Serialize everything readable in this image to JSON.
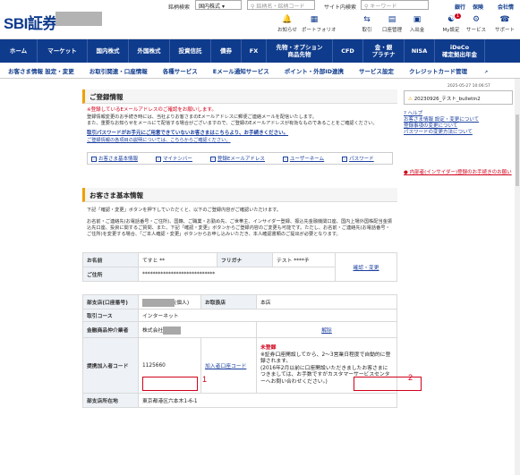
{
  "header": {
    "logo": "SBI証券",
    "stock_search_label": "銘柄検索",
    "stock_search_select": "国内株式",
    "stock_search_placeholder": "銘柄名・銘柄コード",
    "site_search_label": "サイト内検索",
    "site_search_placeholder": "キーワード",
    "links": [
      "銀行",
      "保険",
      "会社情"
    ],
    "icons": [
      {
        "label": "お知らせ",
        "icon": "bell-icon"
      },
      {
        "label": "ポートフォリオ",
        "icon": "portfolio-icon"
      },
      {
        "label": "取引",
        "icon": "trade-icon"
      },
      {
        "label": "口座管理",
        "icon": "account-icon"
      },
      {
        "label": "入出金",
        "icon": "deposit-icon"
      },
      {
        "label": "My設定",
        "icon": "user-icon"
      },
      {
        "label": "サービス",
        "icon": "service-icon"
      },
      {
        "label": "サポート",
        "icon": "support-icon"
      }
    ],
    "badge": "1"
  },
  "nav": [
    "ホーム",
    "マーケット",
    "国内株式",
    "外国株式",
    "投資信託",
    "債券",
    "FX",
    "先物・オプション\n商品先物",
    "CFD",
    "金・銀\nプラチナ",
    "NISA",
    "iDeCo\n確定拠出年金"
  ],
  "subnav": [
    "お客さま情報 設定・変更",
    "お取引関連・口座情報",
    "各種サービス",
    "Eメール通知サービス",
    "ポイント・外部ID連携",
    "サービス設定",
    "クレジットカード管理"
  ],
  "timestamp": "2025-05-27 10:06:57",
  "registration": {
    "title": "ご登録情報",
    "note": "※登録しているEメールアドレスのご確認をお願いします。",
    "para1": "登録情報変更のお手続き時には、当社よりお客さまのEメールアドレスに郵便ご連絡メールを配信いたします。",
    "para2": "また、重要なお知らせをメールにて配信する場合がございますので、ご登録のEメールアドレスが有効なものであることをご確認ください。",
    "link1": "取引パスワードがお手元にご用意できていないお客さまはこちらより、お手続きください。",
    "link2": "ご登録情報の各項目の説明については、こちらからご確認ください。",
    "tabs": [
      "お客さま基本情報",
      "マイナンバー",
      "登録Eメールアドレス",
      "ユーザーネーム",
      "パスワード"
    ]
  },
  "basic": {
    "title": "お客さま基本情報",
    "para1": "下記「確認・変更」ボタンを押下していただくと、以下のご登録内容がご確認いただけます。",
    "para2": "お名前・ご連絡先(お電話番号・ご住所)、国籍、ご職業・お勤め先、ご世帯主、インサイダー登録、振込先金融機関口座、国内上場外国株配当金振込先口座、投資に関するご質問、また、下記「確認・変更」ボタンからご登録内容のご変更も可能です。ただし、お名前・ご連絡先(お電話番号・ご住所)を変更する場合、「ご本人確認・変更」ボタンからお申し込みいただき、本人確認書類のご提出が必要となります。",
    "name_label": "お名前",
    "name_value": "てすと **",
    "furigana_label": "フリガナ",
    "furigana_value": "テスト ****チ",
    "address_label": "ご住所",
    "address_value": "****************************",
    "confirm_link": "確認・変更"
  },
  "account": {
    "branch_label": "部支店(口座番号)",
    "branch_suffix": "(個人)",
    "main_branch_label": "お取扱店",
    "main_branch_value": "本店",
    "course_label": "取引コース",
    "course_value": "インターネット",
    "intermediary_label": "金融商品仲介業者",
    "intermediary_value": "株式会社",
    "cancel_link": "解除",
    "affiliate_label": "提携加入者コード",
    "affiliate_value": "1125660",
    "affiliate_link": "加入者口座コード",
    "unregistered": "未登録",
    "note1": "※証券口座開設してから、2〜3営業日程度で自動的に登録されます。",
    "note2": "(2016年2月以前に口座開設いただきましたお客さまにつきましては、お手数ですがカスタマーサービスセンターへお問い合わせください。)",
    "branch_addr_label": "部支店所在地",
    "branch_addr_value": "東京都港区六本木1-6-1"
  },
  "annotations": [
    "1",
    "2"
  ],
  "sidebar": {
    "file": "20230926_テスト_bulletin2",
    "help_title": "ヘルプ",
    "help_links": [
      "お客さま情報 設定・変更について",
      "登録事項の変更について",
      "パスワードの変更方法について"
    ],
    "warning": "内部者(インサイダー)登録のお手続きのお願い"
  },
  "colors": {
    "brand": "#0f3b8c",
    "alert": "#d0021b",
    "accent": "#f0a000"
  }
}
